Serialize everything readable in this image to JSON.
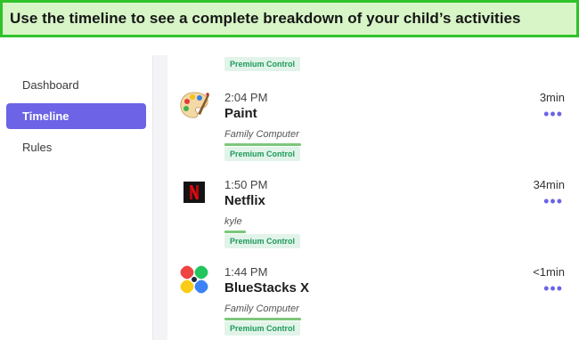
{
  "banner": {
    "text": "Use the timeline to see a complete breakdown of your child’s activities"
  },
  "sidebar": {
    "items": [
      {
        "label": "Dashboard",
        "active": false
      },
      {
        "label": "Timeline",
        "active": true
      },
      {
        "label": "Rules",
        "active": false
      }
    ]
  },
  "timeline": {
    "top_badge": "Premium Control",
    "entries": [
      {
        "time": "2:04 PM",
        "app": "Paint",
        "device": "Family Computer",
        "badge": "Premium Control",
        "duration": "3min",
        "icon": "paint-palette-icon",
        "more": "•••"
      },
      {
        "time": "1:50 PM",
        "app": "Netflix",
        "device": "kyle",
        "badge": "Premium Control",
        "duration": "34min",
        "icon": "netflix-icon",
        "more": "•••"
      },
      {
        "time": "1:44 PM",
        "app": "BlueStacks X",
        "device": "Family Computer",
        "badge": "Premium Control",
        "duration": "<1min",
        "icon": "bluestacks-icon",
        "more": "•••"
      }
    ]
  },
  "colors": {
    "accent": "#6c63e6",
    "banner_bg": "#d7f5c6",
    "banner_border": "#2fc22b",
    "badge_text": "#1f9a5a",
    "badge_bg": "#e2f4ea"
  }
}
